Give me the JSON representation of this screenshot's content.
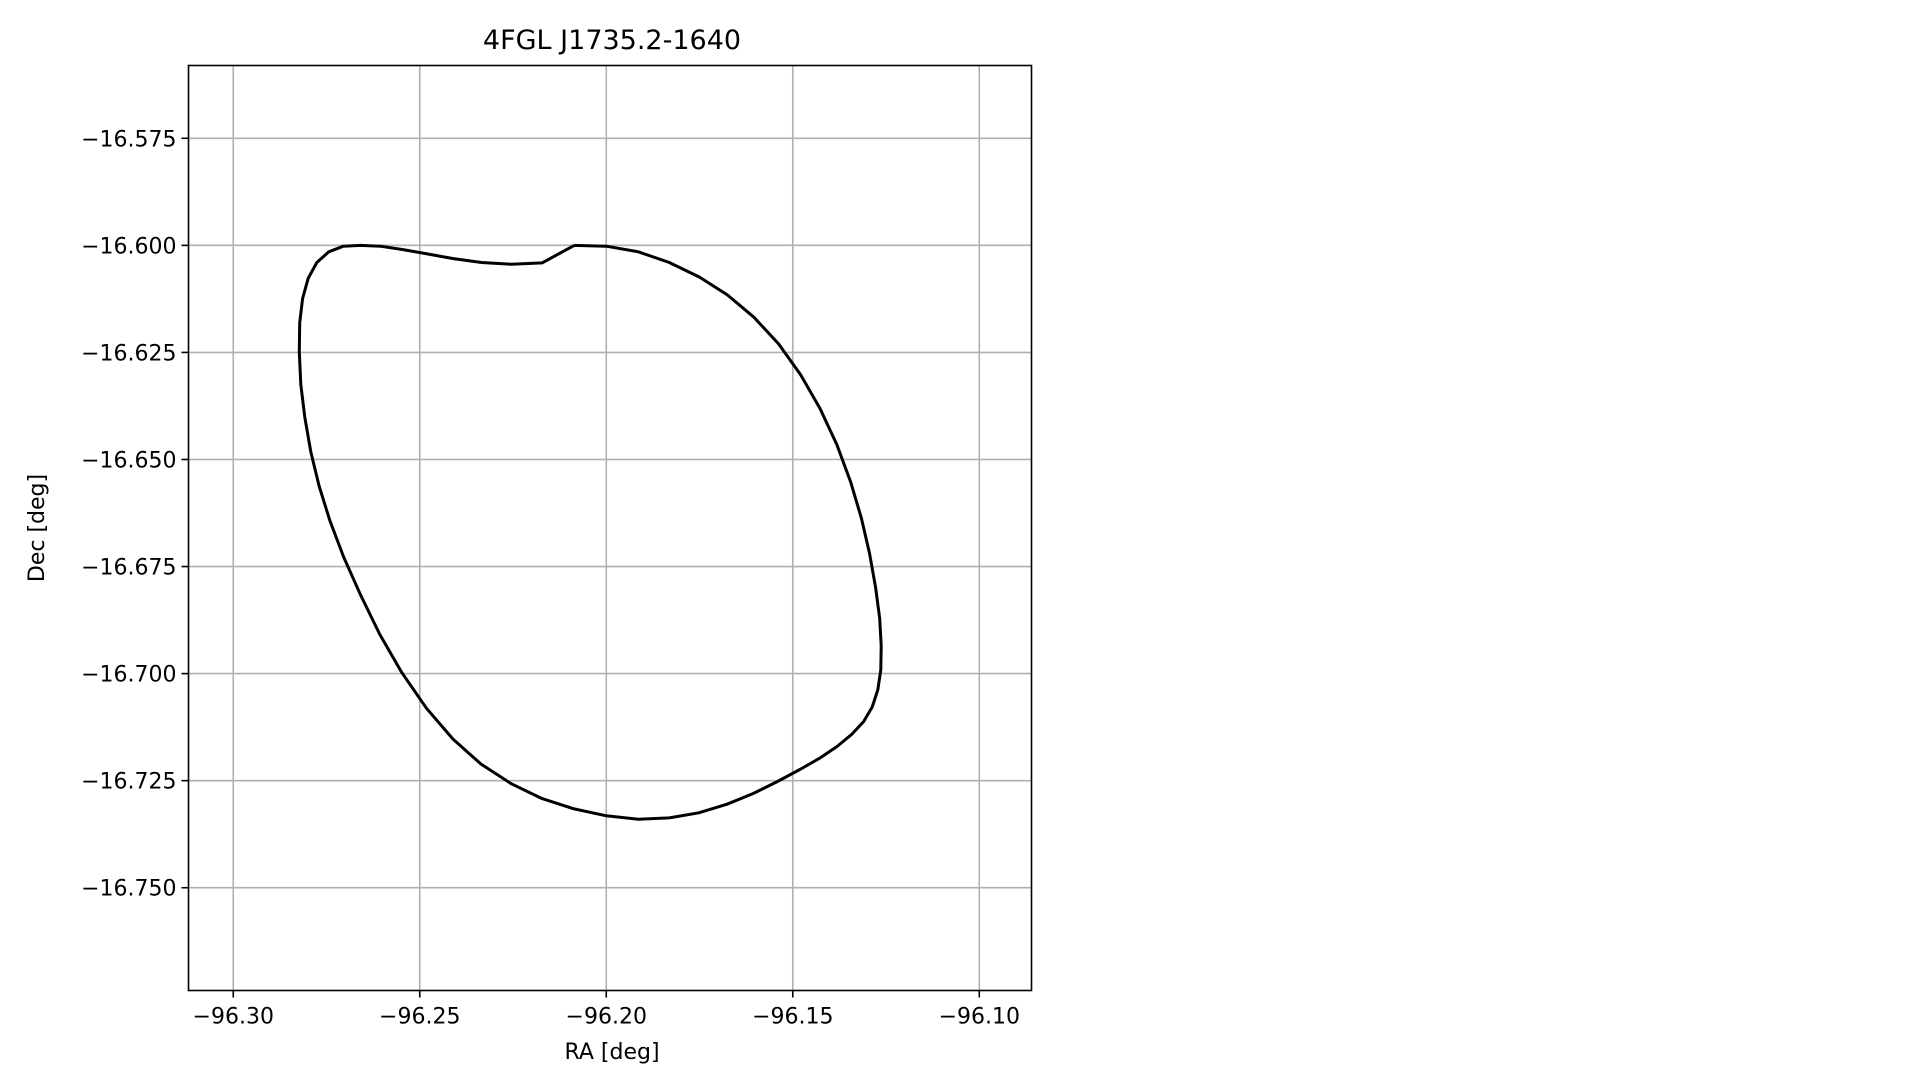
{
  "chart_data": {
    "type": "line",
    "title": "4FGL J1735.2-1640",
    "xlabel": "RA [deg]",
    "ylabel": "Dec [deg]",
    "xlim": [
      -96.312,
      -96.086
    ],
    "ylim": [
      -16.774,
      -16.558
    ],
    "grid": true,
    "xticks": [
      -96.3,
      -96.25,
      -96.2,
      -96.15,
      -96.1
    ],
    "xtick_labels": [
      "−96.30",
      "−96.25",
      "−96.20",
      "−96.15",
      "−96.10"
    ],
    "yticks": [
      -16.575,
      -16.6,
      -16.625,
      -16.65,
      -16.675,
      -16.7,
      -16.725,
      -16.75
    ],
    "ytick_labels": [
      "−16.575",
      "−16.600",
      "−16.625",
      "−16.650",
      "−16.675",
      "−16.700",
      "−16.725",
      "−16.750"
    ],
    "series": [
      {
        "color": "#000000",
        "x": [
          -96.2086,
          -96.2,
          -96.1914,
          -96.1831,
          -96.175,
          -96.1675,
          -96.1604,
          -96.1538,
          -96.1479,
          -96.1427,
          -96.1382,
          -96.1345,
          -96.1316,
          -96.1294,
          -96.1278,
          -96.1267,
          -96.1263,
          -96.1264,
          -96.1272,
          -96.1287,
          -96.131,
          -96.1342,
          -96.1381,
          -96.1427,
          -96.1481,
          -96.1541,
          -96.1606,
          -96.1676,
          -96.1752,
          -96.1831,
          -96.1914,
          -96.2,
          -96.2086,
          -96.2172,
          -96.2255,
          -96.2336,
          -96.2411,
          -96.2482,
          -96.2548,
          -96.2607,
          -96.2659,
          -96.2704,
          -96.2741,
          -96.277,
          -96.2792,
          -96.2808,
          -96.2819,
          -96.2823,
          -96.2822,
          -96.2814,
          -96.2799,
          -96.2776,
          -96.2744,
          -96.2705,
          -96.2659,
          -96.2605,
          -96.2545,
          -96.248,
          -96.241,
          -96.2334,
          -96.2255,
          -96.2172,
          -96.2086
        ],
        "y": [
          -16.6,
          -16.6002,
          -16.6015,
          -16.604,
          -16.6074,
          -16.6116,
          -16.6168,
          -16.623,
          -16.6302,
          -16.6381,
          -16.6465,
          -16.6552,
          -16.6637,
          -16.672,
          -16.6799,
          -16.6871,
          -16.6935,
          -16.6991,
          -16.7038,
          -16.7078,
          -16.7112,
          -16.7142,
          -16.717,
          -16.7197,
          -16.7224,
          -16.7252,
          -16.728,
          -16.7305,
          -16.7325,
          -16.7337,
          -16.734,
          -16.7332,
          -16.7316,
          -16.7292,
          -16.7257,
          -16.7211,
          -16.7153,
          -16.7081,
          -16.6998,
          -16.6909,
          -16.6816,
          -16.6728,
          -16.6643,
          -16.6562,
          -16.6482,
          -16.6403,
          -16.6325,
          -16.6249,
          -16.6181,
          -16.6124,
          -16.6077,
          -16.604,
          -16.6015,
          -16.6002,
          -16.6,
          -16.6002,
          -16.601,
          -16.602,
          -16.6031,
          -16.604,
          -16.6044,
          -16.6041,
          -16.6
        ]
      }
    ]
  }
}
